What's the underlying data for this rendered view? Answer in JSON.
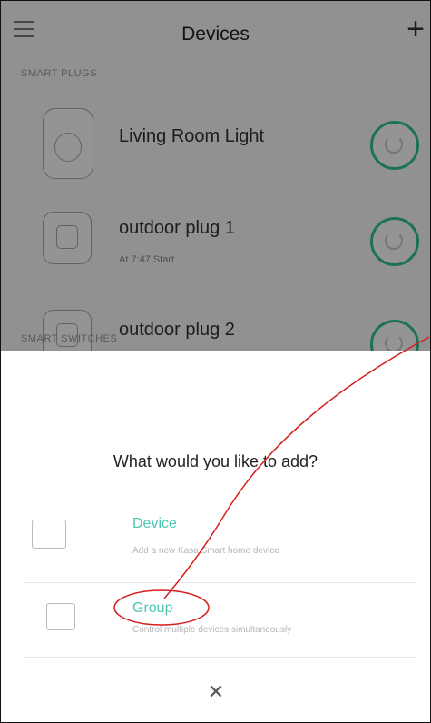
{
  "header": {
    "title": "Devices",
    "menu_icon": "hamburger-menu-icon",
    "add_icon": "plus-icon"
  },
  "sections": {
    "smart_plugs_label": "SMART PLUGS",
    "smart_switches_label": "SMART SWITCHES"
  },
  "devices": [
    {
      "name": "Living Room Light",
      "status": "",
      "icon": "smart-plug-icon"
    },
    {
      "name": "outdoor plug 1",
      "status": "At 7:47 Start",
      "icon": "outdoor-plug-icon"
    },
    {
      "name": "outdoor plug 2",
      "status": "",
      "icon": "outdoor-plug-icon"
    }
  ],
  "sheet": {
    "title": "What would you like to add?",
    "options": [
      {
        "label": "Device",
        "description": "Add a new Kasa Smart home device",
        "icon": "device-outlet-icon"
      },
      {
        "label": "Group",
        "description": "Control multiple devices simultaneously",
        "icon": "group-stack-icon"
      }
    ],
    "close_icon": "close-x-icon"
  },
  "colors": {
    "accent": "#4cc6b0",
    "power_ring": "#35c39a",
    "annotation": "#d32020"
  }
}
